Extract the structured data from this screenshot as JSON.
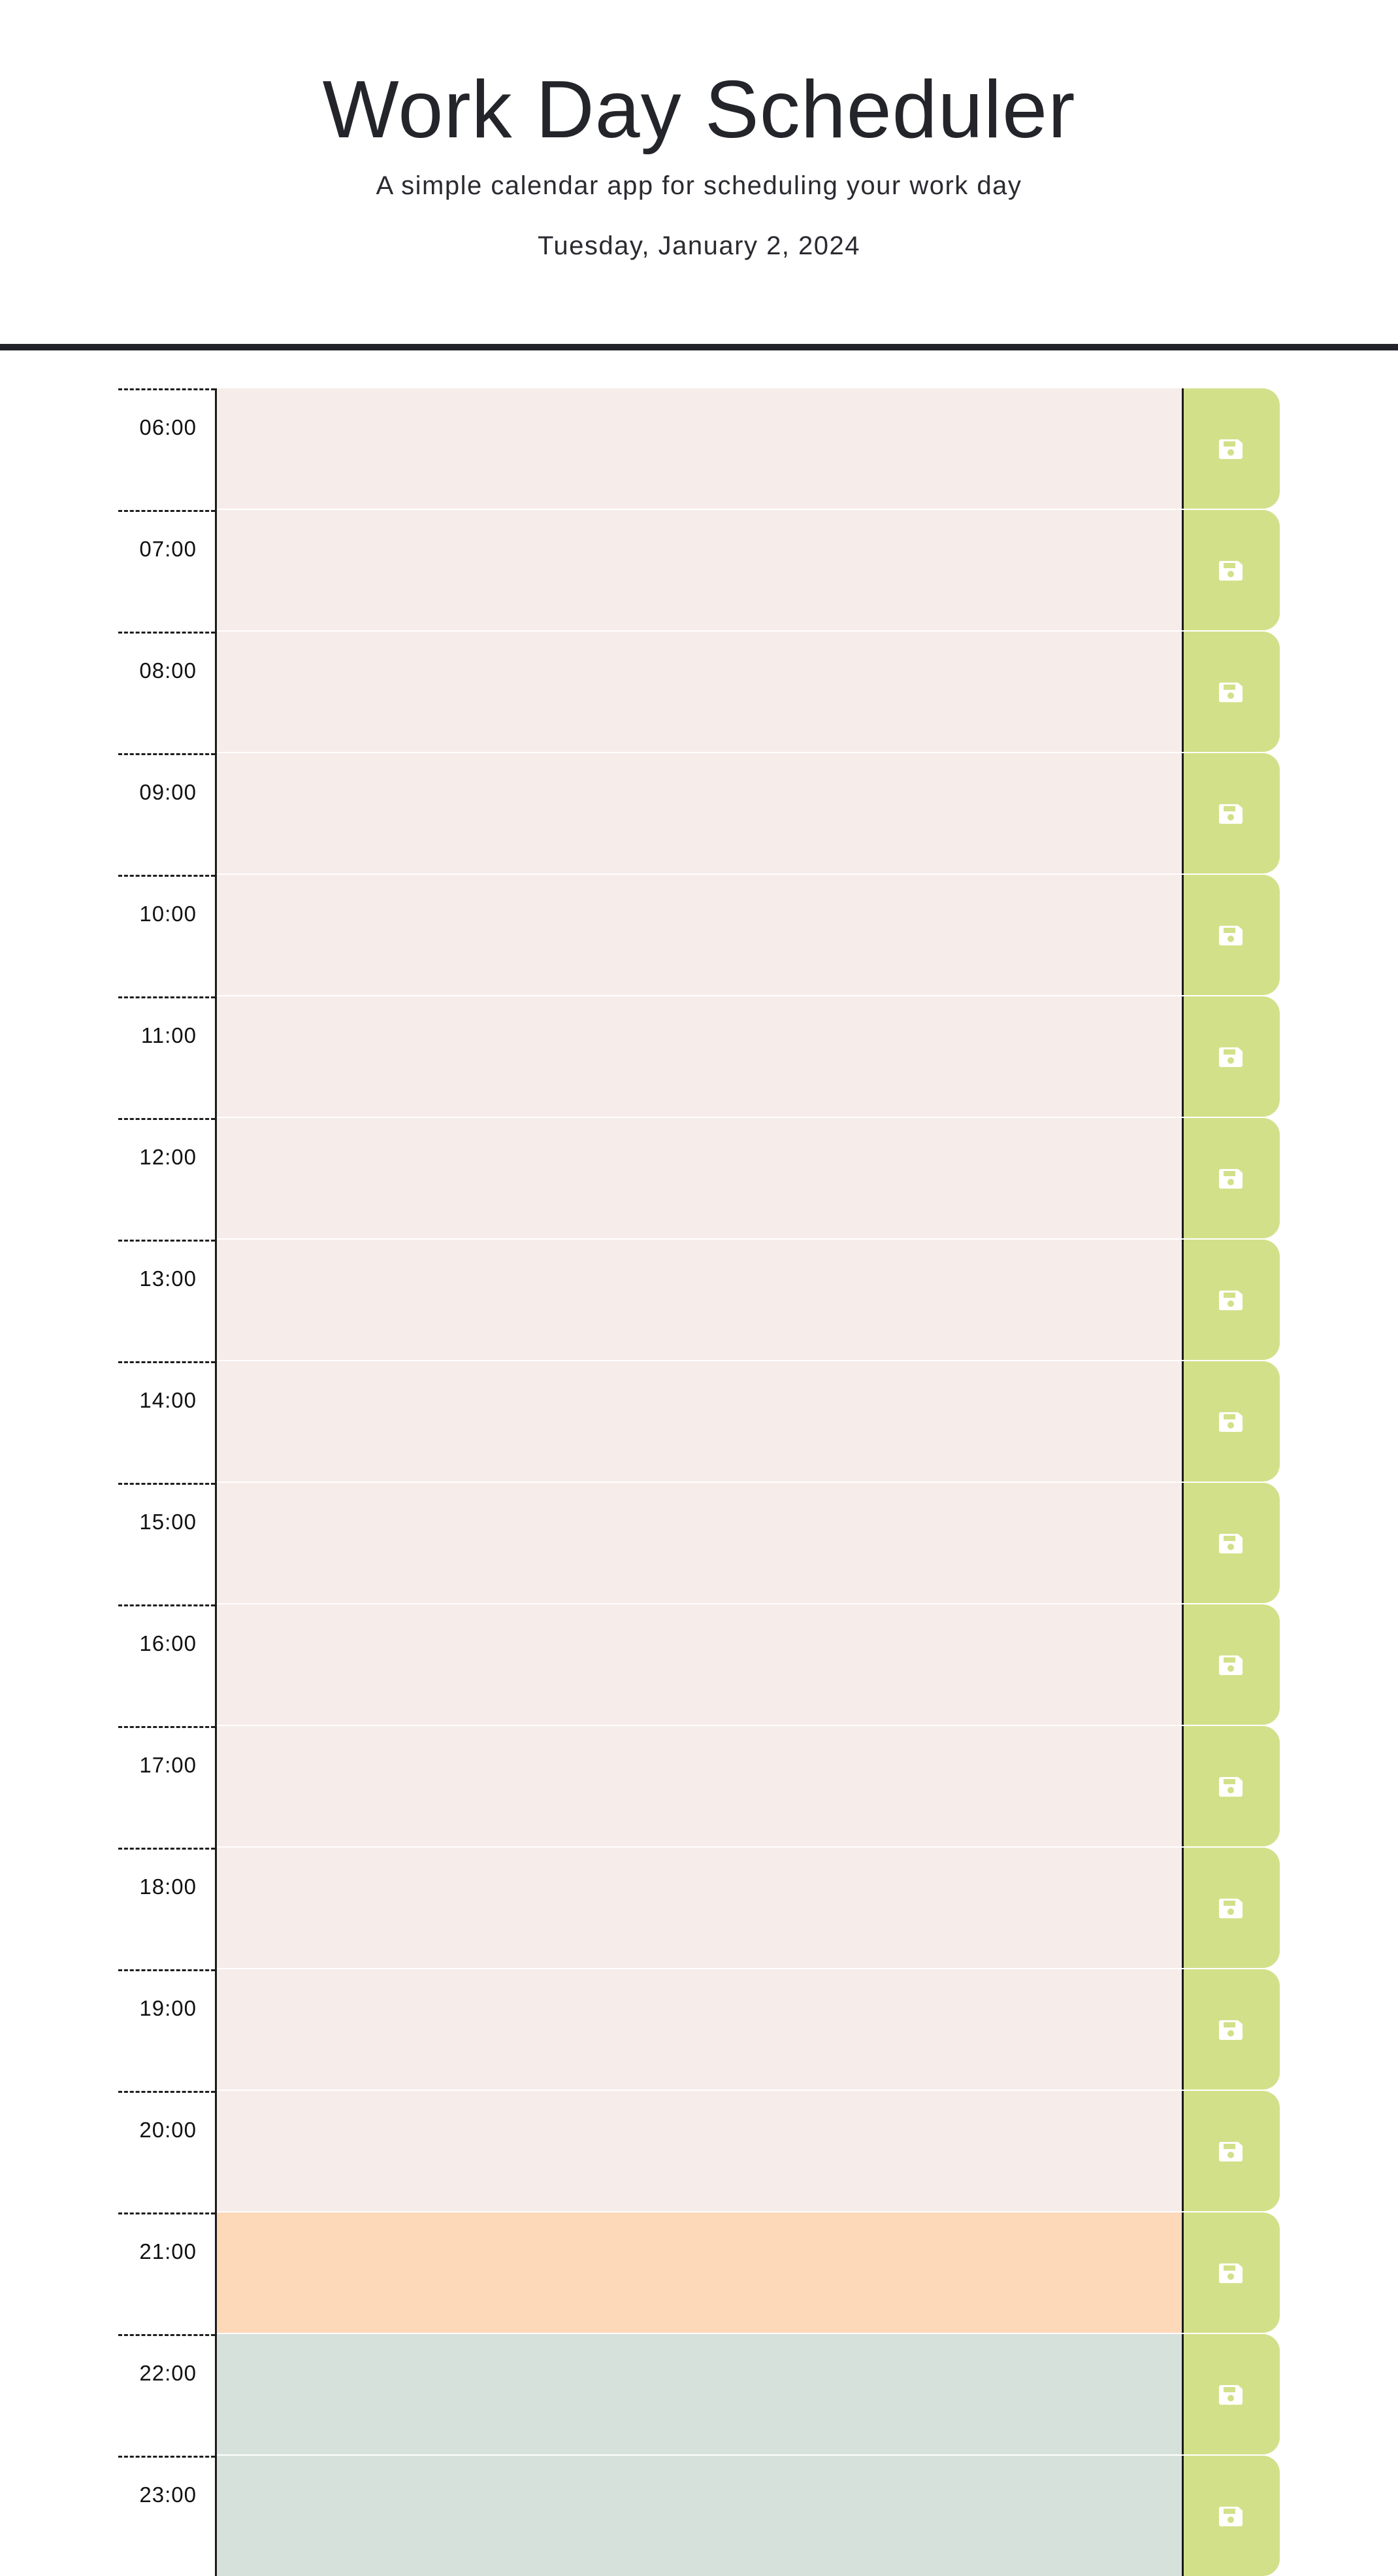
{
  "header": {
    "title": "Work Day Scheduler",
    "lead": "A simple calendar app for scheduling your work day",
    "current_date": "Tuesday, January 2, 2024"
  },
  "colors": {
    "past": "#f6ece9",
    "present": "#fdd8b9",
    "future": "#d7e1dc",
    "save_button": "#d3e08a"
  },
  "save_icon": "floppy-disk-icon",
  "hours": [
    {
      "label": "06:00",
      "state": "past",
      "text": ""
    },
    {
      "label": "07:00",
      "state": "past",
      "text": ""
    },
    {
      "label": "08:00",
      "state": "past",
      "text": ""
    },
    {
      "label": "09:00",
      "state": "past",
      "text": ""
    },
    {
      "label": "10:00",
      "state": "past",
      "text": ""
    },
    {
      "label": "11:00",
      "state": "past",
      "text": ""
    },
    {
      "label": "12:00",
      "state": "past",
      "text": ""
    },
    {
      "label": "13:00",
      "state": "past",
      "text": ""
    },
    {
      "label": "14:00",
      "state": "past",
      "text": ""
    },
    {
      "label": "15:00",
      "state": "past",
      "text": ""
    },
    {
      "label": "16:00",
      "state": "past",
      "text": ""
    },
    {
      "label": "17:00",
      "state": "past",
      "text": ""
    },
    {
      "label": "18:00",
      "state": "past",
      "text": ""
    },
    {
      "label": "19:00",
      "state": "past",
      "text": ""
    },
    {
      "label": "20:00",
      "state": "past",
      "text": ""
    },
    {
      "label": "21:00",
      "state": "present",
      "text": ""
    },
    {
      "label": "22:00",
      "state": "future",
      "text": ""
    },
    {
      "label": "23:00",
      "state": "future",
      "text": ""
    }
  ]
}
